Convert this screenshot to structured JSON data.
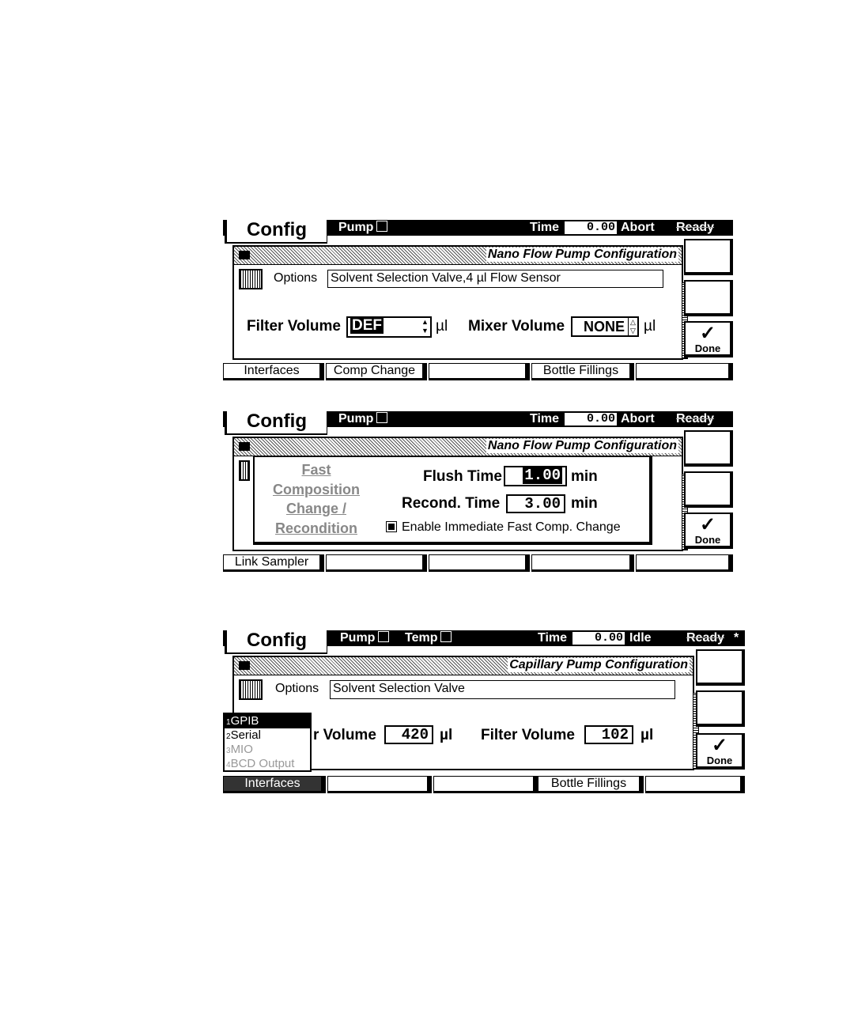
{
  "screen1": {
    "tab": "Config",
    "header": {
      "pump_label": "Pump",
      "time_label": "Time",
      "time_value": "0.00",
      "state": "Abort",
      "status": "Ready"
    },
    "title": "Nano Flow Pump Configuration",
    "options_label": "Options",
    "options_value": "Solvent Selection Valve,4 µl Flow Sensor",
    "filter_label": "Filter Volume",
    "filter_value": "DEF",
    "filter_unit": "µl",
    "mixer_label": "Mixer Volume",
    "mixer_value": "NONE",
    "mixer_unit": "µl",
    "done": "Done",
    "buttons": [
      "Interfaces",
      "Comp Change",
      "",
      "Bottle Fillings",
      ""
    ]
  },
  "screen2": {
    "tab": "Config",
    "header": {
      "pump_label": "Pump",
      "time_label": "Time",
      "time_value": "0.00",
      "state": "Abort",
      "status": "Ready"
    },
    "title": "Nano Flow Pump Configuration",
    "dialog": {
      "heading": [
        "Fast",
        "Composition",
        "Change /",
        "Recondition"
      ],
      "flush_label": "Flush Time",
      "flush_value": "1.00",
      "flush_unit": "min",
      "recond_label": "Recond. Time",
      "recond_value": "3.00",
      "recond_unit": "min",
      "checkbox_label": "Enable Immediate Fast Comp. Change"
    },
    "done": "Done",
    "buttons": [
      "Link Sampler",
      "",
      "",
      "",
      ""
    ]
  },
  "screen3": {
    "tab": "Config",
    "header": {
      "pump_label": "Pump",
      "temp_label": "Temp",
      "time_label": "Time",
      "time_value": "0.00",
      "state": "Idle",
      "status": "Ready",
      "star": "*"
    },
    "title": "Capillary Pump Configuration",
    "options_label": "Options",
    "options_value": "Solvent Selection Valve",
    "mixer_label_partial": "r Volume",
    "mixer_value": "420",
    "mixer_unit": "µl",
    "filter_label": "Filter Volume",
    "filter_value": "102",
    "filter_unit": "µl",
    "interfaces_list": [
      {
        "num": "1",
        "label": "GPIB"
      },
      {
        "num": "2",
        "label": "Serial"
      },
      {
        "num": "3",
        "label": "MIO"
      },
      {
        "num": "4",
        "label": "BCD Output"
      }
    ],
    "done": "Done",
    "buttons": [
      "Interfaces",
      "",
      "",
      "Bottle Fillings",
      ""
    ]
  }
}
